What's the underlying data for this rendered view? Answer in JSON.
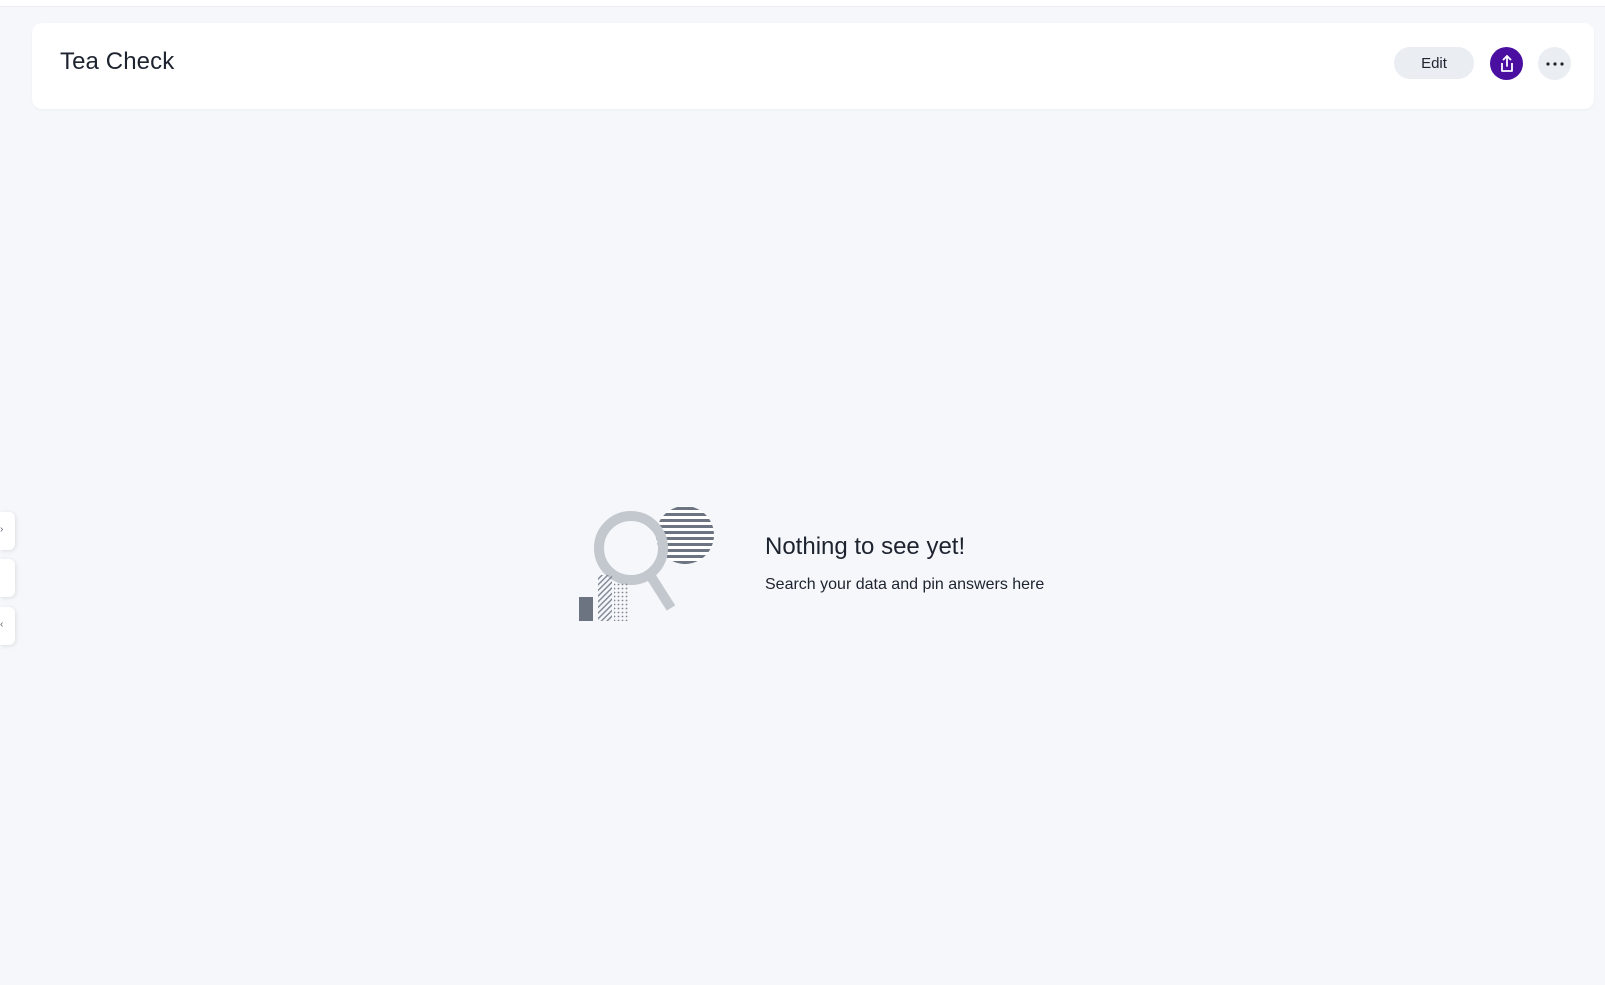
{
  "header": {
    "title": "Tea Check",
    "edit_label": "Edit",
    "share_icon": "share-icon",
    "more_icon": "more-icon"
  },
  "empty_state": {
    "title": "Nothing to see yet!",
    "subtitle": "Search your data and pin answers here",
    "illustration": "search-chart-illustration"
  },
  "side_tabs": {
    "top_glyph": "›",
    "bottom_glyph": "‹"
  },
  "colors": {
    "accent": "#4a0ea0",
    "background": "#f5f7fa",
    "button_bg": "#eaedf2",
    "text": "#1d232f"
  }
}
